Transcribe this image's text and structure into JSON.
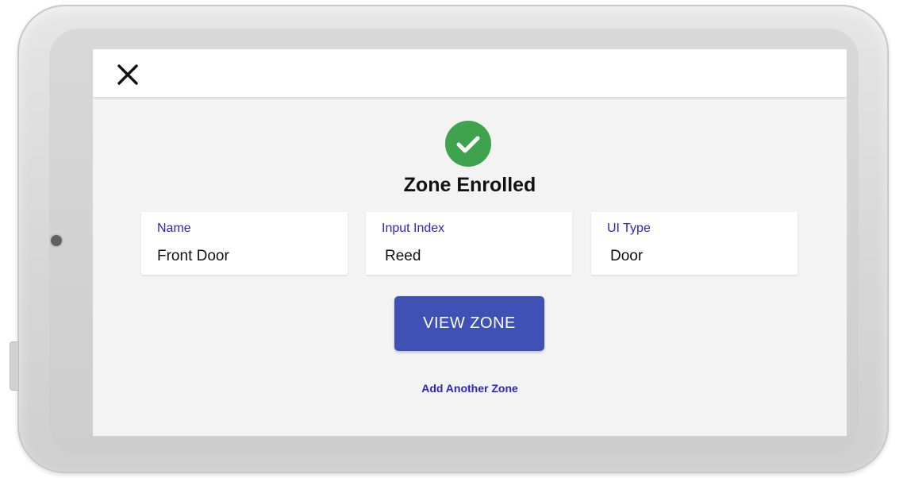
{
  "header": {
    "close_icon": "close-icon"
  },
  "status": {
    "icon": "check-circle-icon",
    "icon_color": "#3fa34d",
    "title": "Zone Enrolled"
  },
  "fields": [
    {
      "label": "Name",
      "value": "Front Door"
    },
    {
      "label": "Input Index",
      "value": "Reed"
    },
    {
      "label": "UI Type",
      "value": "Door"
    }
  ],
  "actions": {
    "primary_label": "VIEW ZONE",
    "primary_color": "#3f51b5",
    "secondary_label": "Add Another Zone",
    "label_color": "#2d24c7"
  }
}
